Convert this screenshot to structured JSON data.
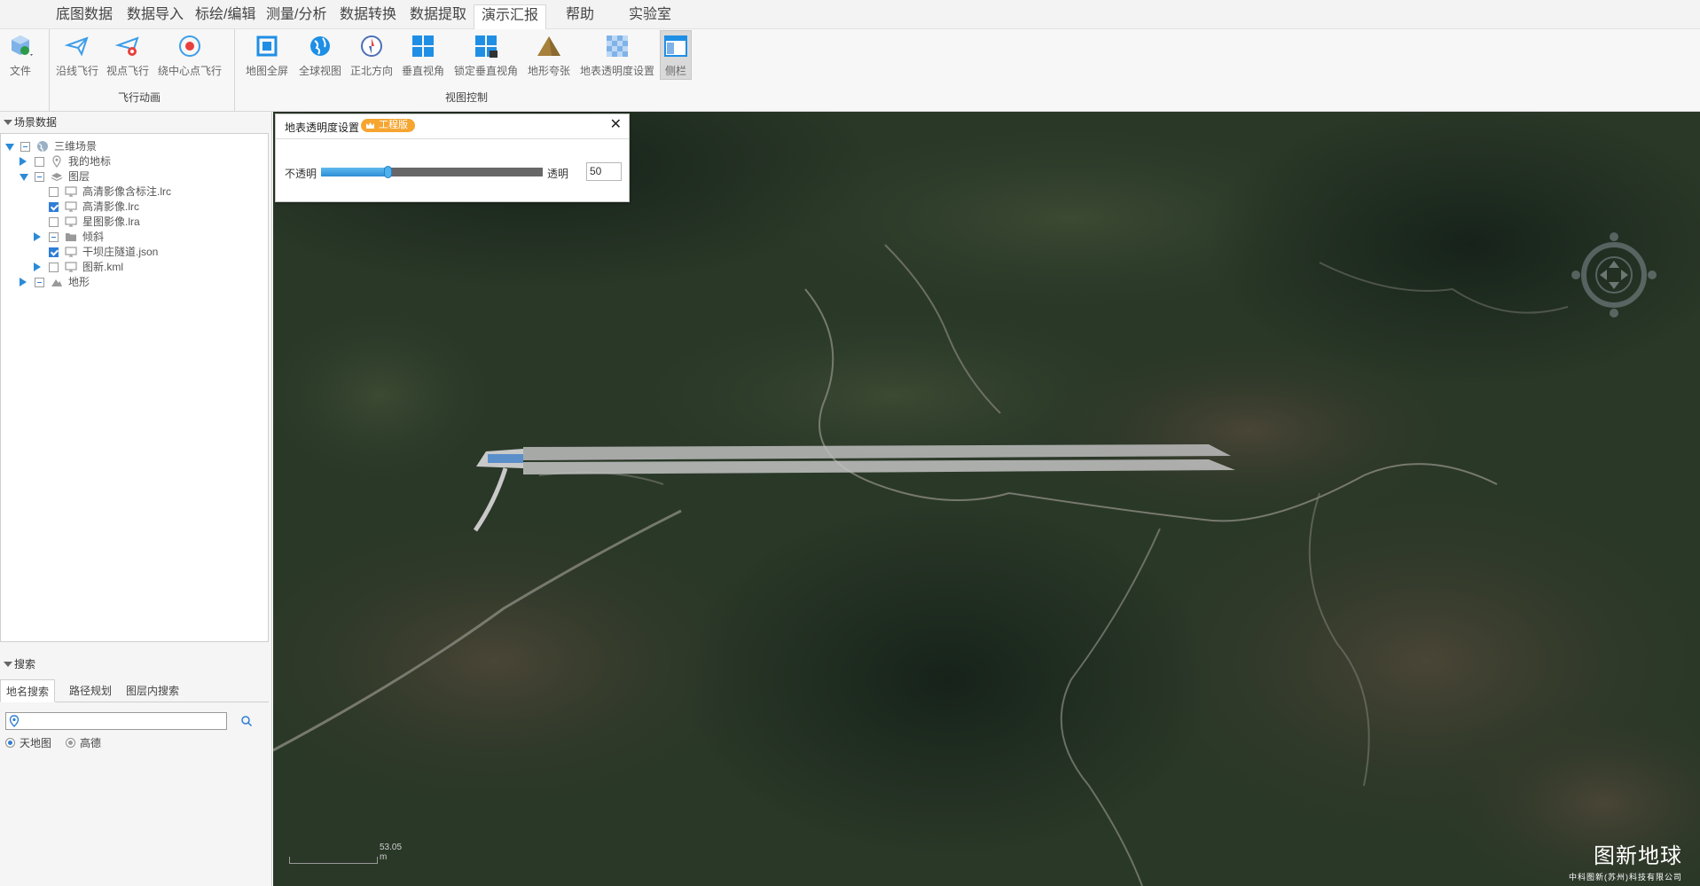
{
  "menu": {
    "tabs": [
      "底图数据",
      "数据导入",
      "标绘/编辑",
      "测量/分析",
      "数据转换",
      "数据提取",
      "演示汇报",
      "帮助",
      "实验室"
    ],
    "active": "演示汇报"
  },
  "ribbon": {
    "file_label": "文件",
    "fly_buttons": [
      "沿线飞行",
      "视点飞行",
      "绕中心点飞行"
    ],
    "fly_group": "飞行动画",
    "view_buttons": [
      "地图全屏",
      "全球视图",
      "正北方向",
      "垂直视角",
      "锁定垂直视角",
      "地形夸张",
      "地表透明度设置",
      "侧栏"
    ],
    "view_group": "视图控制"
  },
  "scene_panel": {
    "title": "场景数据",
    "tree": [
      {
        "label": "三维场景",
        "level": 0,
        "expand": "open",
        "check": "partial",
        "icon": "globe-icon"
      },
      {
        "label": "我的地标",
        "level": 1,
        "expand": "closed",
        "check": "none",
        "icon": "pin-icon"
      },
      {
        "label": "图层",
        "level": 1,
        "expand": "open",
        "check": "partial",
        "icon": "layers-icon"
      },
      {
        "label": "高清影像含标注.lrc",
        "level": 2,
        "expand": "",
        "check": "none",
        "icon": "monitor-icon"
      },
      {
        "label": "高清影像.lrc",
        "level": 2,
        "expand": "",
        "check": "checked",
        "icon": "monitor-icon"
      },
      {
        "label": "星图影像.lra",
        "level": 2,
        "expand": "",
        "check": "none",
        "icon": "monitor-icon"
      },
      {
        "label": "倾斜",
        "level": 2,
        "expand": "closed",
        "check": "partial",
        "icon": "folder-icon"
      },
      {
        "label": "干坝庄隧道.json",
        "level": 2,
        "expand": "",
        "check": "checked",
        "icon": "monitor-icon"
      },
      {
        "label": "图新.kml",
        "level": 2,
        "expand": "closed",
        "check": "none",
        "icon": "monitor-icon"
      },
      {
        "label": "地形",
        "level": 1,
        "expand": "closed",
        "check": "partial",
        "icon": "terrain-icon"
      }
    ]
  },
  "search_panel": {
    "title": "搜索",
    "tabs": [
      "地名搜索",
      "路径规划",
      "图层内搜索"
    ],
    "active_tab": "地名搜索",
    "input_value": "",
    "sources": [
      {
        "label": "天地图",
        "selected": true
      },
      {
        "label": "高德",
        "selected": false
      }
    ]
  },
  "dialog": {
    "title": "地表透明度设置",
    "badge": "工程版",
    "close": "✕",
    "left_label": "不透明",
    "right_label": "透明",
    "value": "50",
    "fraction": 0.5
  },
  "map": {
    "scale_text": "53.05 m",
    "brand_title": "图新地球",
    "brand_sub": "中科图新(苏州)科技有限公司"
  }
}
